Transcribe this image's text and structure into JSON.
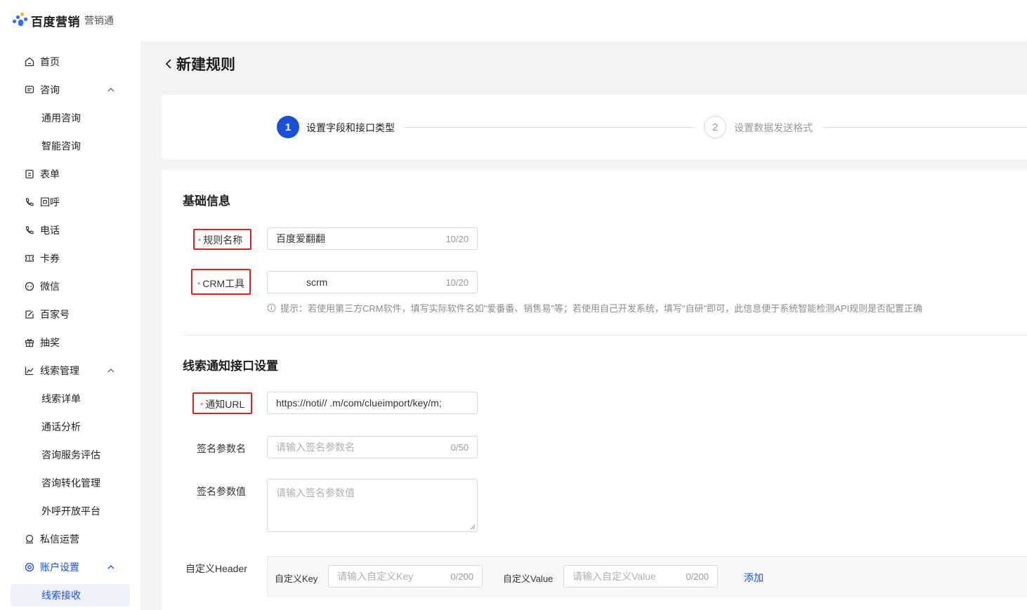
{
  "header": {
    "logo_text": "百度营销",
    "product": "营销通",
    "colors": {
      "accent": "#1a4fd6",
      "logo_blue": "#2f6bff",
      "logo_orange": "#ffb020"
    }
  },
  "sidebar": {
    "items": [
      {
        "label": "首页",
        "icon": "home-icon"
      },
      {
        "label": "咨询",
        "icon": "chat-box-icon"
      },
      {
        "label": "通用咨询"
      },
      {
        "label": "智能咨询"
      },
      {
        "label": "表单",
        "icon": "form-icon"
      },
      {
        "label": "回呼",
        "icon": "callback-icon"
      },
      {
        "label": "电话",
        "icon": "phone-icon"
      },
      {
        "label": "卡券",
        "icon": "coupon-icon"
      },
      {
        "label": "微信",
        "icon": "wechat-icon"
      },
      {
        "label": "百家号",
        "icon": "edit-icon"
      },
      {
        "label": "抽奖",
        "icon": "gift-icon"
      },
      {
        "label": "线索管理",
        "icon": "chart-icon"
      },
      {
        "label": "线索详单"
      },
      {
        "label": "通话分析"
      },
      {
        "label": "咨询服务评估"
      },
      {
        "label": "咨询转化管理"
      },
      {
        "label": "外呼开放平台"
      },
      {
        "label": "私信运营",
        "icon": "private-message-icon"
      },
      {
        "label": "账户设置",
        "icon": "settings-icon"
      },
      {
        "label": "线索接收"
      }
    ]
  },
  "page": {
    "title": "新建规则"
  },
  "steps": [
    {
      "number": "1",
      "label": "设置字段和接口类型",
      "active": true
    },
    {
      "number": "2",
      "label": "设置数据发送格式",
      "active": false
    }
  ],
  "form": {
    "basic_title": "基础信息",
    "rule_name": {
      "label": "规则名称",
      "value": "百度爱翻翻",
      "count": "10/20"
    },
    "crm_tool": {
      "label": "CRM工具",
      "value": "scrm",
      "count": "10/20"
    },
    "hint": "提示：若使用第三方CRM软件，填写实际软件名如\"爱番番、销售易\"等；若使用自己开发系统，填写\"自研\"即可，此信息便于系统智能检测API规则是否配置正确",
    "notify_title": "线索通知接口设置",
    "notify_url": {
      "label": "通知URL",
      "value": "https://noti//      .m/com/clueimport/key/m;"
    },
    "sign_name": {
      "label": "签名参数名",
      "placeholder": "请输入签名参数名",
      "count": "0/50"
    },
    "sign_value": {
      "label": "签名参数值",
      "placeholder": "请输入签名参数值"
    },
    "custom_header": {
      "label": "自定义Header",
      "key_label": "自定义Key",
      "key_placeholder": "请输入自定义Key",
      "key_count": "0/200",
      "value_label": "自定义Value",
      "value_placeholder": "请输入自定义Value",
      "value_count": "0/200",
      "add_label": "添加"
    }
  }
}
